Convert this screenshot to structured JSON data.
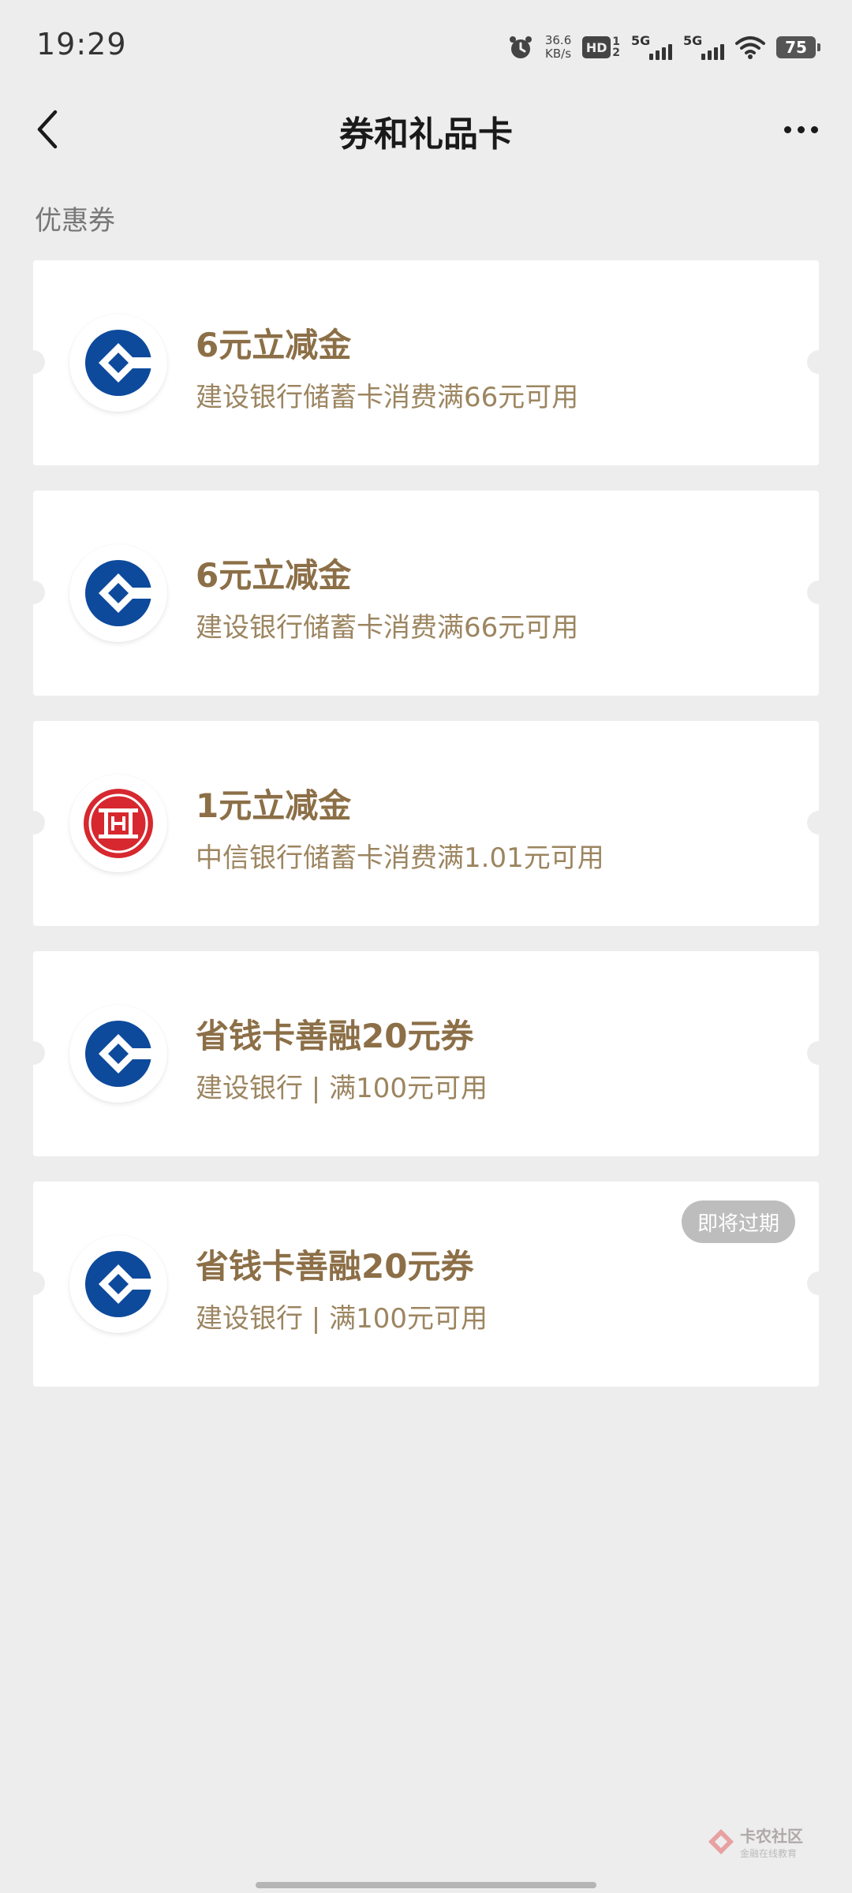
{
  "status_bar": {
    "time": "19:29",
    "net_speed_value": "36.6",
    "net_speed_unit": "KB/s",
    "hd_label": "HD",
    "sim_numbers": [
      "1",
      "2"
    ],
    "network_1": "5G",
    "network_2": "5G",
    "battery": "75",
    "icons": [
      "alarm-icon",
      "wifi-icon",
      "battery-icon",
      "signal-icon"
    ]
  },
  "nav": {
    "title": "券和礼品卡",
    "back_icon": "chevron-left-icon",
    "more_icon": "more-dots-icon"
  },
  "section": {
    "label": "优惠券"
  },
  "coupons": [
    {
      "bank": "ccb",
      "title": "6元立减金",
      "desc": "建设银行储蓄卡消费满66元可用"
    },
    {
      "bank": "ccb",
      "title": "6元立减金",
      "desc": "建设银行储蓄卡消费满66元可用"
    },
    {
      "bank": "citic",
      "title": "1元立减金",
      "desc": "中信银行储蓄卡消费满1.01元可用"
    },
    {
      "bank": "ccb",
      "title": "省钱卡善融20元券",
      "desc": "建设银行 | 满100元可用"
    },
    {
      "bank": "ccb",
      "title": "省钱卡善融20元券",
      "desc": "建设银行 | 满100元可用",
      "badge": "即将过期"
    }
  ],
  "watermark": {
    "main": "卡农社区",
    "sub": "金融在线教育"
  },
  "colors": {
    "background": "#ededed",
    "card": "#ffffff",
    "coupon_title": "#8c6f47",
    "coupon_desc": "#9c8560",
    "ccb_blue": "#0d4a9c",
    "citic_red": "#d7282f",
    "badge_bg": "#bdbdbd"
  }
}
